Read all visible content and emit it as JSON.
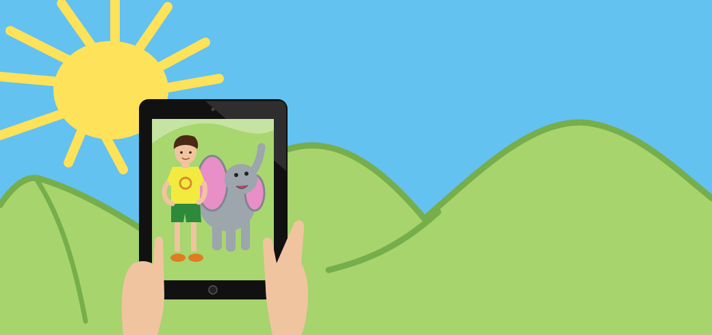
{
  "colors": {
    "sky": "#63c2f0",
    "sun": "#fde25a",
    "hill_fill": "#a7d46d",
    "hill_outline": "#77ae4c",
    "tablet_body": "#111111",
    "tablet_screen": "#a8d66f",
    "skin": "#f1c4a0",
    "elephant": "#9da5ad",
    "elephant_ear": "#e98fc7",
    "boy_shirt": "#f3ea3f",
    "boy_shorts": "#2c8a3a"
  },
  "elements": {
    "sun": "drawn-sun",
    "hills": "drawn-green-hills",
    "device": "tablet",
    "characters": [
      "cartoon-boy",
      "cartoon-elephant"
    ],
    "hands": [
      "left-hand",
      "right-hand"
    ]
  }
}
